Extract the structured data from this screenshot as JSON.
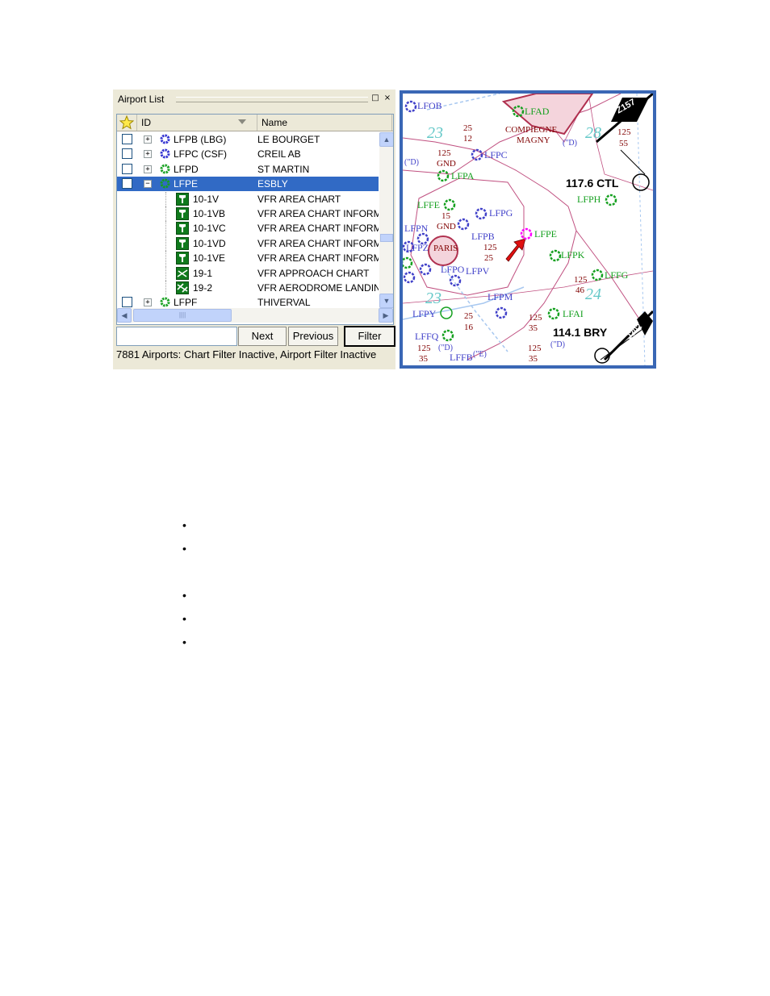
{
  "panel": {
    "title": "Airport List",
    "restore_glyph": "□",
    "close_glyph": "×",
    "columns": {
      "id": "ID",
      "name": "Name"
    },
    "rows": [
      {
        "id": "LFPB (LBG)",
        "name": "LE BOURGET",
        "expander": "+",
        "kind": "airport",
        "icon": "airport-blue-icon"
      },
      {
        "id": "LFPC (CSF)",
        "name": "CREIL AB",
        "expander": "+",
        "kind": "airport",
        "icon": "airport-blue-icon"
      },
      {
        "id": "LFPD",
        "name": "ST MARTIN",
        "expander": "+",
        "kind": "airport",
        "icon": "airport-green-icon"
      },
      {
        "id": "LFPE",
        "name": "ESBLY",
        "expander": "−",
        "kind": "airport",
        "icon": "airport-green-icon",
        "selected": true
      },
      {
        "id": "10-1V",
        "name": "VFR AREA CHART",
        "kind": "chart",
        "icon": "area-chart-icon"
      },
      {
        "id": "10-1VB",
        "name": "VFR AREA CHART INFORM",
        "kind": "chart",
        "icon": "area-chart-icon"
      },
      {
        "id": "10-1VC",
        "name": "VFR AREA CHART INFORM",
        "kind": "chart",
        "icon": "area-chart-icon"
      },
      {
        "id": "10-1VD",
        "name": "VFR AREA CHART INFORM",
        "kind": "chart",
        "icon": "area-chart-icon"
      },
      {
        "id": "10-1VE",
        "name": "VFR AREA CHART INFORM",
        "kind": "chart",
        "icon": "area-chart-icon"
      },
      {
        "id": "19-1",
        "name": "VFR APPROACH CHART",
        "kind": "chart",
        "icon": "approach-chart-icon"
      },
      {
        "id": "19-2",
        "name": "VFR AERODROME LANDIN(",
        "kind": "chart",
        "icon": "aerodrome-chart-icon"
      },
      {
        "id": "LFPF",
        "name": "THIVERVAL",
        "expander": "+",
        "kind": "airport",
        "icon": "airport-green-icon"
      }
    ],
    "scroll": {
      "up": "▲",
      "down": "▼",
      "left": "◀",
      "right": "▶",
      "grip": "||||"
    },
    "search_value": "",
    "buttons": {
      "next": "Next",
      "previous": "Previous",
      "filter": "Filter"
    },
    "status": "7881 Airports: Chart Filter Inactive, Airport Filter Inactive"
  },
  "map": {
    "labels": {
      "lfob": "LFOB",
      "lfad": "LFAD",
      "z157": "Z157",
      "compiegne": "COMPIEGNE",
      "magny": "MAGNY",
      "lfpc": "LFPC",
      "lfpa": "LFPA",
      "ctl": "117.6 CTL",
      "lfph": "LFPH",
      "lffe": "LFFE",
      "lfpg": "LFPG",
      "lfpn": "LFPN",
      "gnd": "GND",
      "lfpb": "LFPB",
      "lfpe": "LFPE",
      "lfpz": "LFPZ",
      "paris": "PARIS",
      "lfpo": "LFPO",
      "lfpv": "LFPV",
      "lfpk": "LFPK",
      "lffg": "LFFG",
      "lfpm": "LFPM",
      "lfpy": "LFPY",
      "lfai": "LFAI",
      "bry": "114.1 BRY",
      "j302": "J302",
      "lffq": "LFFQ",
      "lffb": "LFFB",
      "n23a": "23",
      "n28": "28",
      "n23b": "23",
      "n24": "24",
      "alt_125": "125",
      "alt_12": "12",
      "alt_25": "25",
      "alt_55": "55",
      "alt_15": "15",
      "alt_16": "16",
      "alt_35": "35",
      "alt_46": "46",
      "class_d": "(\"D)",
      "class_e": "(\"E)"
    }
  },
  "colors": {
    "selection": "#316ac5",
    "map_frame": "#3a67b5",
    "highlight": "#ff00ff",
    "arrow": "#e01010"
  }
}
